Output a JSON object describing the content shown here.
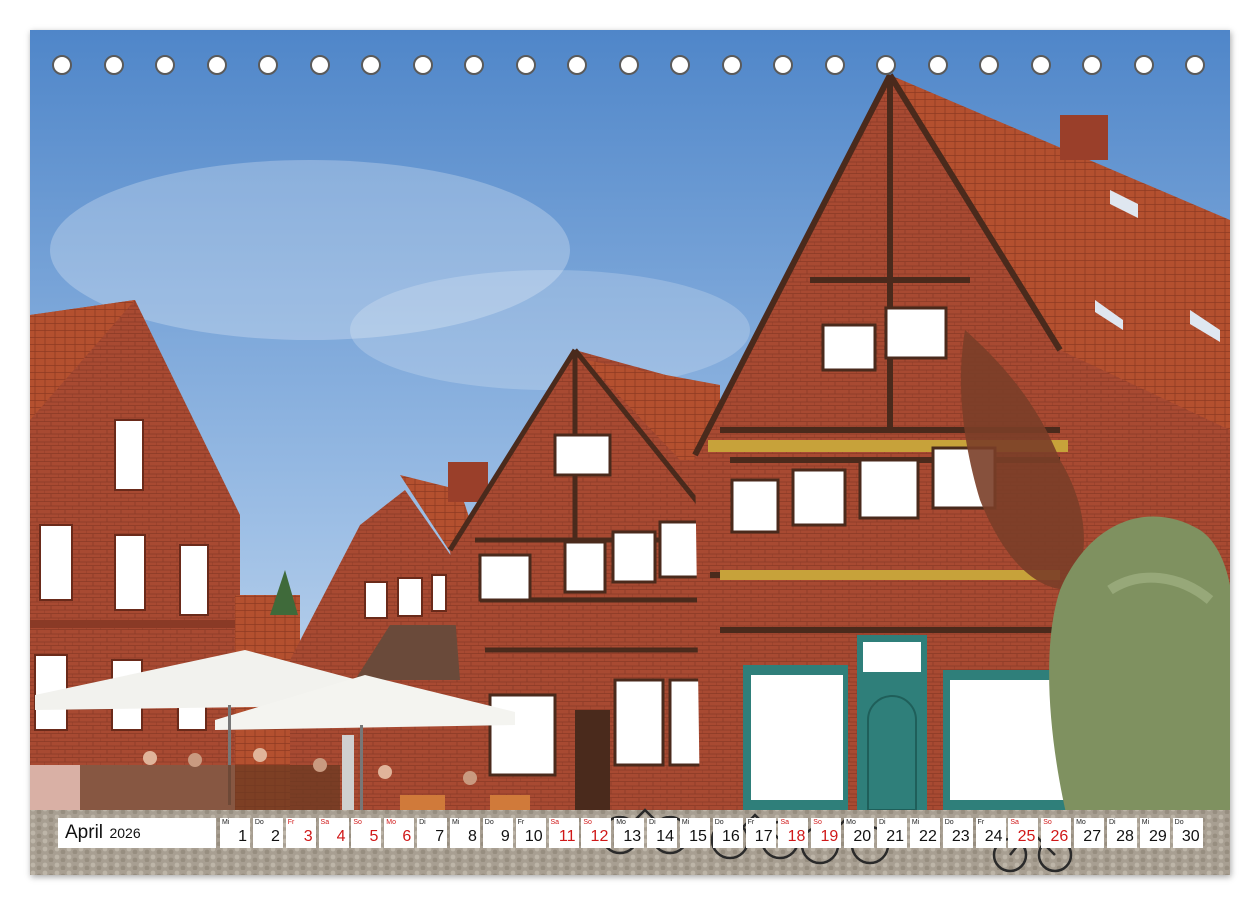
{
  "calendar": {
    "month": "April",
    "year": "2026",
    "days": [
      {
        "wd": "Mi",
        "num": "1",
        "weekend": false
      },
      {
        "wd": "Do",
        "num": "2",
        "weekend": false
      },
      {
        "wd": "Fr",
        "num": "3",
        "weekend": true
      },
      {
        "wd": "Sa",
        "num": "4",
        "weekend": true
      },
      {
        "wd": "So",
        "num": "5",
        "weekend": true
      },
      {
        "wd": "Mo",
        "num": "6",
        "weekend": true
      },
      {
        "wd": "Di",
        "num": "7",
        "weekend": false
      },
      {
        "wd": "Mi",
        "num": "8",
        "weekend": false
      },
      {
        "wd": "Do",
        "num": "9",
        "weekend": false
      },
      {
        "wd": "Fr",
        "num": "10",
        "weekend": false
      },
      {
        "wd": "Sa",
        "num": "11",
        "weekend": true
      },
      {
        "wd": "So",
        "num": "12",
        "weekend": true
      },
      {
        "wd": "Mo",
        "num": "13",
        "weekend": false
      },
      {
        "wd": "Di",
        "num": "14",
        "weekend": false
      },
      {
        "wd": "Mi",
        "num": "15",
        "weekend": false
      },
      {
        "wd": "Do",
        "num": "16",
        "weekend": false
      },
      {
        "wd": "Fr",
        "num": "17",
        "weekend": false
      },
      {
        "wd": "Sa",
        "num": "18",
        "weekend": true
      },
      {
        "wd": "So",
        "num": "19",
        "weekend": true
      },
      {
        "wd": "Mo",
        "num": "20",
        "weekend": false
      },
      {
        "wd": "Di",
        "num": "21",
        "weekend": false
      },
      {
        "wd": "Mi",
        "num": "22",
        "weekend": false
      },
      {
        "wd": "Do",
        "num": "23",
        "weekend": false
      },
      {
        "wd": "Fr",
        "num": "24",
        "weekend": false
      },
      {
        "wd": "Sa",
        "num": "25",
        "weekend": true
      },
      {
        "wd": "So",
        "num": "26",
        "weekend": true
      },
      {
        "wd": "Mo",
        "num": "27",
        "weekend": false
      },
      {
        "wd": "Di",
        "num": "28",
        "weekend": false
      },
      {
        "wd": "Mi",
        "num": "29",
        "weekend": false
      },
      {
        "wd": "Do",
        "num": "30",
        "weekend": false
      }
    ]
  },
  "binding": {
    "hole_count": 23
  },
  "colors": {
    "sky_top": "#4f86c9",
    "sky_bottom": "#c9dcef",
    "brick": "#a84a32",
    "roof": "#b4502f",
    "timber": "#4a2a1c",
    "window_frame": "#ffffff",
    "teal_door": "#2f7f7a",
    "umbrella": "#f2f2ee",
    "cobblestone": "#a89f92",
    "foliage": "#7f9160",
    "weekend_red": "#d01818"
  }
}
